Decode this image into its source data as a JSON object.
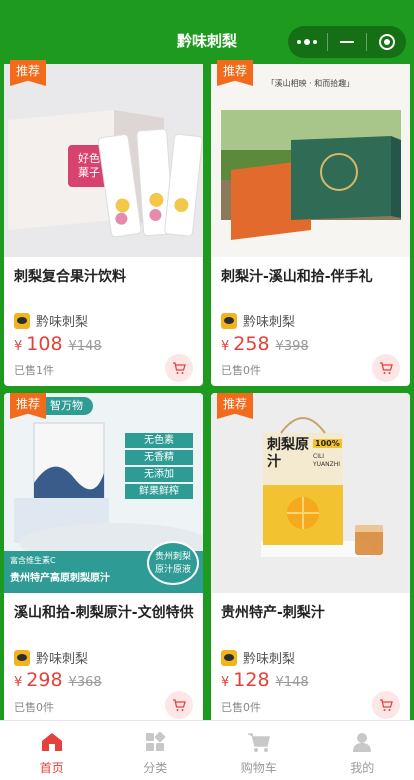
{
  "header": {
    "title": "黔味刺梨"
  },
  "capsule": {
    "more_icon": "more-dots-icon",
    "minimize_icon": "minimize-icon",
    "close_icon": "target-close-icon"
  },
  "colors": {
    "brand_green": "#1e9a1e",
    "price_red": "#e6403a",
    "ribbon_orange": "#f26a1b"
  },
  "products": [
    {
      "badge": "推荐",
      "name": "刺梨复合果汁饮料",
      "shop": "黔味刺梨",
      "currency": "¥",
      "price": "108",
      "original_price": "¥148",
      "sold": "已售1件",
      "image": {
        "box_text_1": "好色",
        "box_text_2": "菓子"
      }
    },
    {
      "badge": "推荐",
      "name": "刺梨汁-溪山和拾-伴手礼",
      "shop": "黔味刺梨",
      "currency": "¥",
      "price": "258",
      "original_price": "¥398",
      "sold": "已售0件",
      "image": {
        "caption": "「溪山相映 · 和而拾趣」"
      }
    },
    {
      "badge": "推荐",
      "name": "溪山和拾-刺梨原汁-文创特供",
      "shop": "黔味刺梨",
      "currency": "¥",
      "price": "298",
      "original_price": "¥368",
      "sold": "已售0件",
      "image": {
        "top_label": "智万物",
        "tags": [
          "无色素",
          "无香精",
          "无添加",
          "鲜果鲜榨"
        ],
        "bottom_small": "富含维生素C",
        "bottom_big": "贵州特产高原刺梨原汁",
        "seal_line1": "贵州刺梨",
        "seal_line2": "原汁原液"
      }
    },
    {
      "badge": "推荐",
      "name": "贵州特产-刺梨汁",
      "shop": "黔味刺梨",
      "currency": "¥",
      "price": "128",
      "original_price": "¥148",
      "sold": "已售0件",
      "image": {
        "box_title": "刺梨原汁",
        "box_side": "100%",
        "box_sub": "CILI YUANZHI"
      }
    }
  ],
  "tabbar": [
    {
      "label": "首页",
      "icon": "home-icon",
      "active": true
    },
    {
      "label": "分类",
      "icon": "category-icon",
      "active": false
    },
    {
      "label": "购物车",
      "icon": "cart-icon",
      "active": false
    },
    {
      "label": "我的",
      "icon": "user-icon",
      "active": false
    }
  ]
}
